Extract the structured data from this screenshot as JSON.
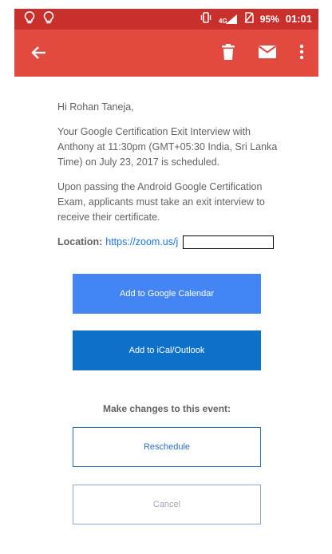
{
  "status_bar": {
    "network": "4G",
    "battery": "95%",
    "time": "01:01"
  },
  "email": {
    "greeting": "Hi Rohan Taneja,",
    "paragraph1": "Your Google Certification Exit Interview with Anthony at 11:30pm (GMT+05:30 India, Sri Lanka Time) on July 23, 2017 is scheduled.",
    "paragraph2": "Upon passing the Android Google Certification Exam, applicants must take an exit interview to receive their certificate.",
    "location_label": "Location:",
    "location_link": "https://zoom.us/j"
  },
  "buttons": {
    "google_calendar": "Add to Google Calendar",
    "ical_outlook": "Add to iCal/Outlook",
    "make_changes": "Make changes to this event:",
    "reschedule": "Reschedule",
    "cancel": "Cancel"
  },
  "colors": {
    "app_bar": "#e34a3f",
    "status_bar": "#c9302c",
    "google_button": "#4385f4",
    "ical_button": "#0d71c9",
    "link": "#1a73e8"
  }
}
